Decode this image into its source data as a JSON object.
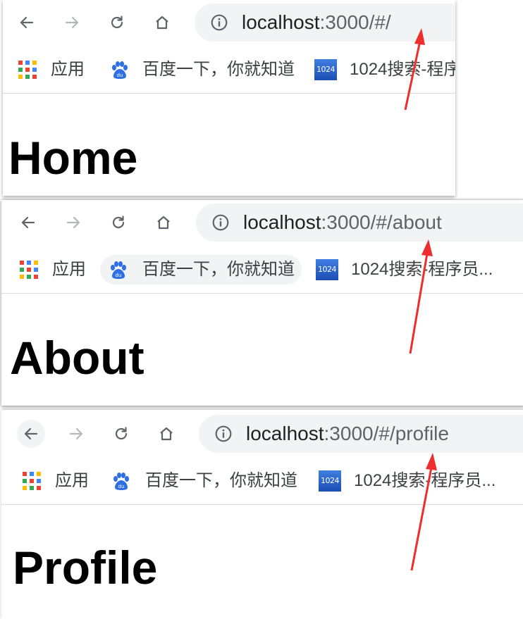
{
  "accent_color": "#f02d2d",
  "icons": [
    "back-icon",
    "forward-icon",
    "reload-icon",
    "home-icon",
    "info-icon",
    "apps-icon",
    "baidu-paw-icon",
    "site-1024-icon"
  ],
  "bookmarks": {
    "apps": "应用",
    "baidu": "百度一下，你就知道",
    "site_1024": "1024搜索-程序",
    "site_1024_full": "1024搜索-程序员...",
    "favicon_1024": "1024"
  },
  "screens": [
    {
      "url_host": "localhost",
      "url_tail": ":3000/#/",
      "page_heading": "Home"
    },
    {
      "url_host": "localhost",
      "url_tail": ":3000/#/about",
      "page_heading": "About"
    },
    {
      "url_host": "localhost",
      "url_tail": ":3000/#/profile",
      "page_heading": "Profile"
    }
  ]
}
